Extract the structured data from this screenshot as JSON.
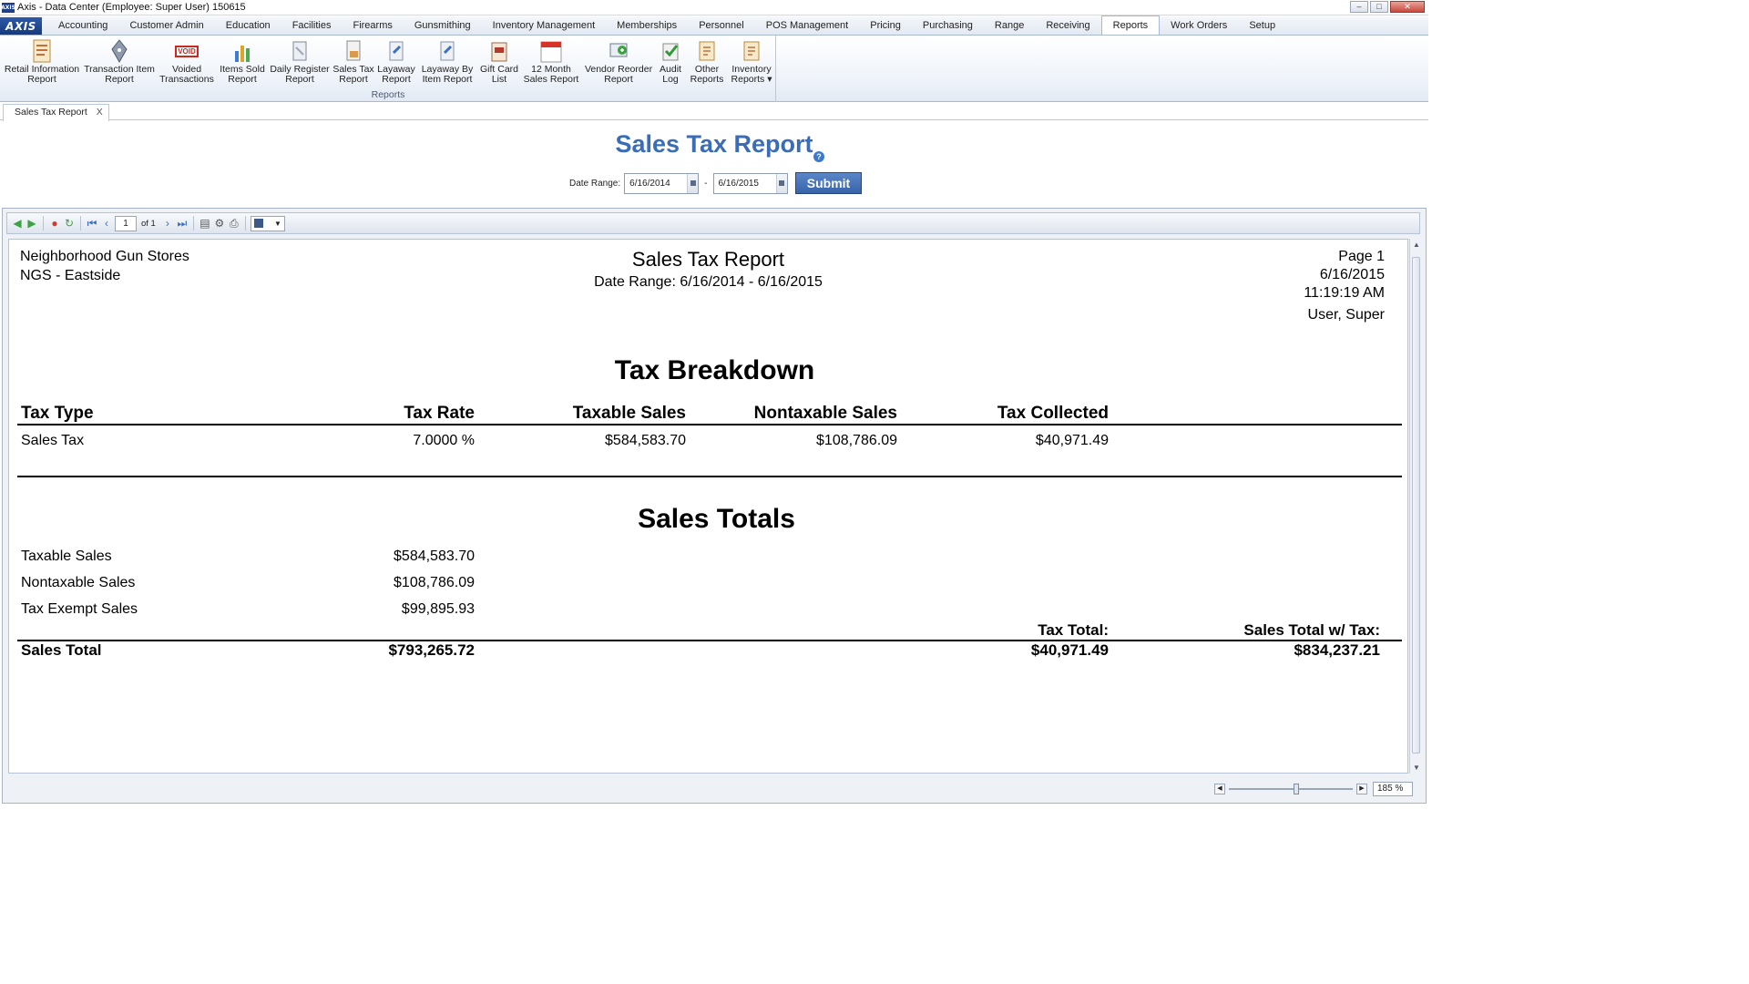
{
  "window": {
    "title": "Axis - Data Center  (Employee: Super User) 150615",
    "logo_text": "AXIS",
    "minimize": "‒",
    "maximize": "□",
    "close": "✕"
  },
  "menu": {
    "logo": "AXIS",
    "tabs": [
      "Accounting",
      "Customer Admin",
      "Education",
      "Facilities",
      "Firearms",
      "Gunsmithing",
      "Inventory Management",
      "Memberships",
      "Personnel",
      "POS Management",
      "Pricing",
      "Purchasing",
      "Range",
      "Receiving",
      "Reports",
      "Work Orders",
      "Setup"
    ],
    "active": "Reports"
  },
  "ribbon": {
    "group_label": "Reports",
    "buttons": [
      {
        "line1": "Retail Information",
        "line2": "Report",
        "icon": "report-form-icon"
      },
      {
        "line1": "Transaction Item",
        "line2": "Report",
        "icon": "pen-nib-icon"
      },
      {
        "line1": "Voided",
        "line2": "Transactions",
        "icon": "void-stamp-icon",
        "icon_text": "VOID"
      },
      {
        "line1": "Items Sold",
        "line2": "Report",
        "icon": "bar-chart-icon"
      },
      {
        "line1": "Daily Register",
        "line2": "Report",
        "icon": "register-icon"
      },
      {
        "line1": "Sales Tax",
        "line2": "Report",
        "icon": "tax-document-icon"
      },
      {
        "line1": "Layaway",
        "line2": "Report",
        "icon": "layaway-icon"
      },
      {
        "line1": "Layaway By",
        "line2": "Item Report",
        "icon": "layaway-item-icon"
      },
      {
        "line1": "Gift Card",
        "line2": "List",
        "icon": "gift-card-icon"
      },
      {
        "line1": "12 Month",
        "line2": "Sales Report",
        "icon": "calendar-icon"
      },
      {
        "line1": "Vendor Reorder",
        "line2": "Report",
        "icon": "reorder-icon"
      },
      {
        "line1": "Audit",
        "line2": "Log",
        "icon": "audit-check-icon"
      },
      {
        "line1": "Other",
        "line2": "Reports",
        "icon": "other-reports-icon"
      },
      {
        "line1": "Inventory",
        "line2": "Reports ▾",
        "icon": "inventory-reports-icon"
      }
    ]
  },
  "doc_tab": {
    "label": "Sales Tax Report",
    "close": "X"
  },
  "page": {
    "title": "Sales Tax Report",
    "help": "?",
    "date_label": "Date Range:",
    "date_from": "6/16/2014",
    "date_sep": "-",
    "date_to": "6/16/2015",
    "submit": "Submit"
  },
  "viewer": {
    "page_input": "1",
    "of_pages": "of 1",
    "zoom": "185 %"
  },
  "report": {
    "company": "Neighborhood Gun Stores",
    "store": "NGS - Eastside",
    "title": "Sales Tax Report",
    "date_range": "Date Range: 6/16/2014 - 6/16/2015",
    "page": "Page 1",
    "date": "6/16/2015",
    "time": "11:19:19 AM",
    "user": "User, Super",
    "breakdown": {
      "heading": "Tax Breakdown",
      "columns": [
        "Tax Type",
        "Tax Rate",
        "Taxable Sales",
        "Nontaxable Sales",
        "Tax Collected"
      ],
      "rows": [
        [
          "Sales Tax",
          "7.0000 %",
          "$584,583.70",
          "$108,786.09",
          "$40,971.49"
        ]
      ]
    },
    "totals": {
      "heading": "Sales Totals",
      "rows": [
        {
          "label": "Taxable Sales",
          "value": "$584,583.70"
        },
        {
          "label": "Nontaxable Sales",
          "value": "$108,786.09"
        },
        {
          "label": "Tax Exempt Sales",
          "value": "$99,895.93"
        }
      ],
      "tax_total_label": "Tax Total:",
      "sales_total_tax_label": "Sales Total w/ Tax:",
      "sales_total_label": "Sales Total",
      "sales_total_value": "$793,265.72",
      "tax_total_value": "$40,971.49",
      "sales_total_tax_value": "$834,237.21"
    }
  }
}
